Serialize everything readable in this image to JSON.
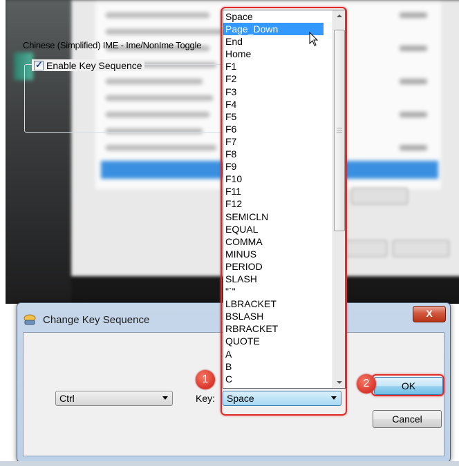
{
  "dialog": {
    "title": "Change Key Sequence",
    "close_label": "X",
    "description": "Chinese (Simplified) IME - Ime/NonIme Toggle",
    "enable_label": "Enable Key Sequence",
    "enable_checked": true,
    "modifier_value": "Ctrl",
    "key_label": "Key:",
    "key_value": "Space",
    "ok_label": "OK",
    "cancel_label": "Cancel"
  },
  "dropdown": {
    "options": [
      "Space",
      "Page_Down",
      "End",
      "Home",
      "F1",
      "F2",
      "F3",
      "F4",
      "F5",
      "F6",
      "F7",
      "F8",
      "F9",
      "F10",
      "F11",
      "F12",
      "SEMICLN",
      "EQUAL",
      "COMMA",
      "MINUS",
      "PERIOD",
      "SLASH",
      "\"`\"",
      "LBRACKET",
      "BSLASH",
      "RBRACKET",
      "QUOTE",
      "A",
      "B",
      "C"
    ],
    "hovered_option": "Page_Down"
  },
  "annotations": {
    "step1": "1",
    "step2": "2",
    "highlight_color": "#e02a2a"
  },
  "colors": {
    "selection": "#3399ff",
    "dialog_frame": "#bcd0e8"
  }
}
